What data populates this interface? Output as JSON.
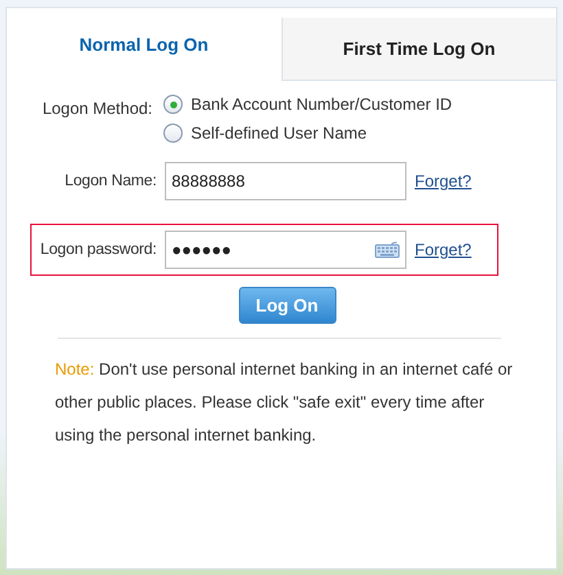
{
  "tabs": [
    {
      "label": "Normal Log On",
      "selected": true
    },
    {
      "label": "First Time Log On",
      "selected": false
    }
  ],
  "logon_method": {
    "label": "Logon Method:",
    "options": [
      {
        "label": "Bank Account Number/Customer ID",
        "selected": true
      },
      {
        "label": "Self-defined User Name",
        "selected": false
      }
    ]
  },
  "fields": [
    {
      "label": "Logon Name:",
      "value": "88888888",
      "keyboard": false,
      "highlighted": false,
      "link": "Forget?"
    },
    {
      "label": "Logon password:",
      "value": "●●●●●●",
      "keyboard": true,
      "highlighted": true,
      "link": "Forget?"
    }
  ],
  "submit": "Log On",
  "note": {
    "label": "Note:",
    "text": "Don't use personal internet banking in an internet café or other public places. Please click \"safe exit\" every time after using the personal internet banking."
  }
}
